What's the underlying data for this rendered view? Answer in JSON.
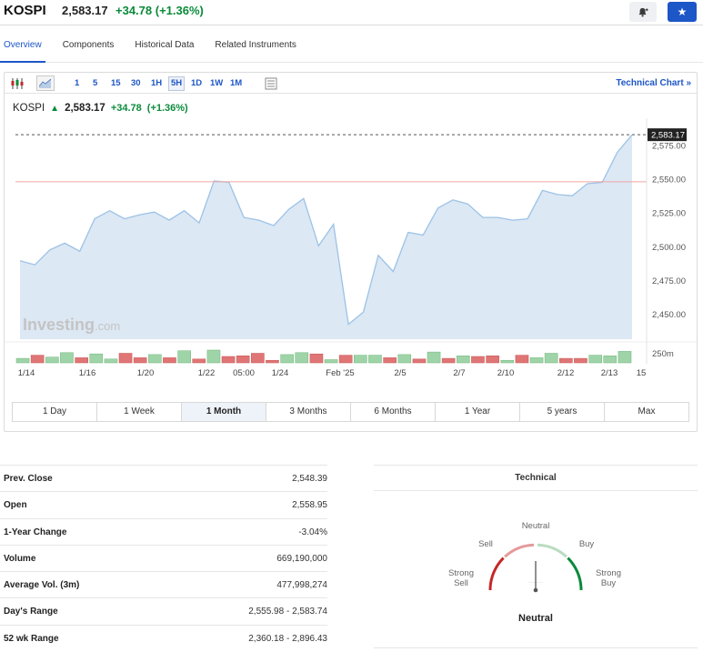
{
  "header": {
    "symbol": "KOSPI",
    "price": "2,583.17",
    "change": "+34.78",
    "change_pct": "(+1.36%)",
    "alert_icon": "bell-plus-icon",
    "watchlist_icon": "star-icon"
  },
  "tabs": [
    {
      "label": "Overview",
      "active": true
    },
    {
      "label": "Components",
      "active": false
    },
    {
      "label": "Historical Data",
      "active": false
    },
    {
      "label": "Related Instruments",
      "active": false
    }
  ],
  "toolbar": {
    "intervals": [
      "1",
      "5",
      "15",
      "30",
      "1H",
      "5H",
      "1D",
      "1W",
      "1M"
    ],
    "selected_interval": "5H",
    "technical_chart_label": "Technical Chart",
    "technical_chart_arrow": "»"
  },
  "legend": {
    "symbol": "KOSPI",
    "arrow": "▲",
    "price": "2,583.17",
    "change": "+34.78",
    "change_pct": "(+1.36%)"
  },
  "chart_data": {
    "type": "area",
    "y_ticks": [
      "2,575.00",
      "2,550.00",
      "2,525.00",
      "2,500.00",
      "2,475.00",
      "2,450.00"
    ],
    "y_tick_values": [
      2575,
      2550,
      2525,
      2500,
      2475,
      2450
    ],
    "ylim": [
      2432,
      2590
    ],
    "last_price_label": "2,583.17",
    "last_price": 2583.17,
    "prev_close": 2548.39,
    "volume_scale_label": "250m",
    "x_labels": [
      "1/14",
      "1/16",
      "1/20",
      "1/22",
      "05:00",
      "1/24",
      "Feb '25",
      "2/5",
      "2/7",
      "2/10",
      "2/12",
      "2/13",
      "15"
    ],
    "watermark": "Investing",
    "watermark_suffix": ".com",
    "series": [
      {
        "values": [
          2490,
          2487,
          2498,
          2503,
          2497,
          2521,
          2527,
          2521,
          2524,
          2526,
          2520,
          2527,
          2518,
          2549,
          2548,
          2522,
          2520,
          2516,
          2528,
          2536,
          2501,
          2517,
          2443,
          2452,
          2494,
          2482,
          2511,
          2509,
          2529,
          2535,
          2532,
          2522,
          2522,
          2520,
          2521,
          2542,
          2539,
          2538,
          2547,
          2548,
          2570,
          2583.17
        ]
      }
    ],
    "volume": [
      {
        "v": 0.35,
        "up": true
      },
      {
        "v": 0.6,
        "up": false
      },
      {
        "v": 0.45,
        "up": true
      },
      {
        "v": 0.8,
        "up": true
      },
      {
        "v": 0.4,
        "up": false
      },
      {
        "v": 0.7,
        "up": true
      },
      {
        "v": 0.3,
        "up": true
      },
      {
        "v": 0.75,
        "up": false
      },
      {
        "v": 0.4,
        "up": false
      },
      {
        "v": 0.65,
        "up": true
      },
      {
        "v": 0.4,
        "up": false
      },
      {
        "v": 0.95,
        "up": true
      },
      {
        "v": 0.3,
        "up": false
      },
      {
        "v": 1.0,
        "up": true
      },
      {
        "v": 0.5,
        "up": false
      },
      {
        "v": 0.55,
        "up": false
      },
      {
        "v": 0.75,
        "up": false
      },
      {
        "v": 0.2,
        "up": false
      },
      {
        "v": 0.65,
        "up": true
      },
      {
        "v": 0.8,
        "up": true
      },
      {
        "v": 0.7,
        "up": false
      },
      {
        "v": 0.25,
        "up": true
      },
      {
        "v": 0.6,
        "up": false
      },
      {
        "v": 0.6,
        "up": true
      },
      {
        "v": 0.6,
        "up": true
      },
      {
        "v": 0.4,
        "up": false
      },
      {
        "v": 0.65,
        "up": true
      },
      {
        "v": 0.3,
        "up": false
      },
      {
        "v": 0.85,
        "up": true
      },
      {
        "v": 0.35,
        "up": false
      },
      {
        "v": 0.55,
        "up": true
      },
      {
        "v": 0.5,
        "up": false
      },
      {
        "v": 0.55,
        "up": false
      },
      {
        "v": 0.2,
        "up": true
      },
      {
        "v": 0.6,
        "up": false
      },
      {
        "v": 0.4,
        "up": true
      },
      {
        "v": 0.75,
        "up": true
      },
      {
        "v": 0.35,
        "up": false
      },
      {
        "v": 0.35,
        "up": false
      },
      {
        "v": 0.6,
        "up": true
      },
      {
        "v": 0.55,
        "up": true
      },
      {
        "v": 0.9,
        "up": true
      }
    ]
  },
  "periods": [
    {
      "label": "1 Day",
      "active": false
    },
    {
      "label": "1 Week",
      "active": false
    },
    {
      "label": "1 Month",
      "active": true
    },
    {
      "label": "3 Months",
      "active": false
    },
    {
      "label": "6 Months",
      "active": false
    },
    {
      "label": "1 Year",
      "active": false
    },
    {
      "label": "5 years",
      "active": false
    },
    {
      "label": "Max",
      "active": false
    }
  ],
  "stats": [
    {
      "label": "Prev. Close",
      "value": "2,548.39"
    },
    {
      "label": "Open",
      "value": "2,558.95"
    },
    {
      "label": "1-Year Change",
      "value": "-3.04%"
    },
    {
      "label": "Volume",
      "value": "669,190,000"
    },
    {
      "label": "Average Vol. (3m)",
      "value": "477,998,274"
    },
    {
      "label": "Day's Range",
      "value": "2,555.98 - 2,583.74"
    },
    {
      "label": "52 wk Range",
      "value": "2,360.18 - 2,896.43"
    }
  ],
  "technical": {
    "title": "Technical",
    "labels": {
      "neutral": "Neutral",
      "sell": "Sell",
      "buy": "Buy",
      "strong_sell": "Strong\nSell",
      "strong_buy": "Strong\nBuy"
    },
    "result": "Neutral",
    "gauge_level": 0.5
  },
  "colors": {
    "accent": "#1d56c7",
    "positive": "#0a8a3a",
    "negative": "#c62828",
    "area_fill": "#dce8f4",
    "area_line": "#9cc2e6",
    "vol_up": "#9fd4a8",
    "vol_down": "#e07575",
    "prev_close_line": "#f1a5a5"
  }
}
